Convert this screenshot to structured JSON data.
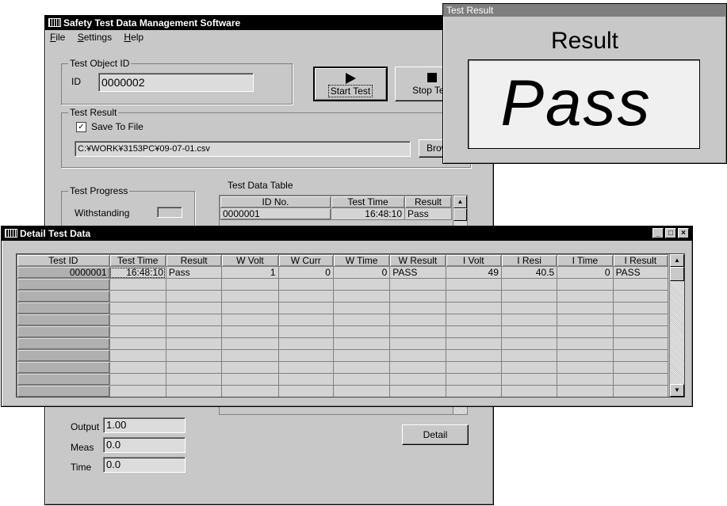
{
  "main_window": {
    "title": "Safety Test Data Management Software",
    "menu": [
      {
        "key": "F",
        "rest": "ile"
      },
      {
        "key": "S",
        "rest": "ettings"
      },
      {
        "key": "H",
        "rest": "elp"
      }
    ],
    "test_object": {
      "group_label": "Test Object ID",
      "id_label": "ID",
      "id_value": "0000002"
    },
    "buttons": {
      "start": "Start Test",
      "stop": "Stop Test",
      "browse": "Browse",
      "detail": "Detail"
    },
    "test_result": {
      "group_label": "Test Result",
      "save_to_file_label": "Save To File",
      "save_to_file_checked": true,
      "file_path": "C:¥WORK¥3153PC¥09-07-01.csv"
    },
    "test_progress": {
      "group_label": "Test Progress",
      "withstanding_label": "Withstanding"
    },
    "test_data_table": {
      "label": "Test Data Table",
      "columns": [
        "ID No.",
        "Test Time",
        "Result"
      ],
      "rows": [
        [
          "0000001",
          "16:48:10",
          "Pass"
        ]
      ]
    },
    "readouts": {
      "output_label": "Output",
      "output_value": "1.00",
      "meas_label": "Meas",
      "meas_value": "0.0",
      "time_label": "Time",
      "time_value": "0.0"
    }
  },
  "result_window": {
    "title": "Test Result",
    "heading": "Result",
    "value": "Pass"
  },
  "detail_window": {
    "title": "Detail Test Data",
    "columns": [
      "Test ID",
      "Test Time",
      "Result",
      "W Volt",
      "W Curr",
      "W Time",
      "W Result",
      "I Volt",
      "I Resi",
      "I Time",
      "I Result"
    ],
    "rows": [
      [
        "0000001",
        "16:48:10",
        "Pass",
        "1",
        "0",
        "0",
        "PASS",
        "49",
        "40.5",
        "0",
        "PASS"
      ]
    ]
  }
}
